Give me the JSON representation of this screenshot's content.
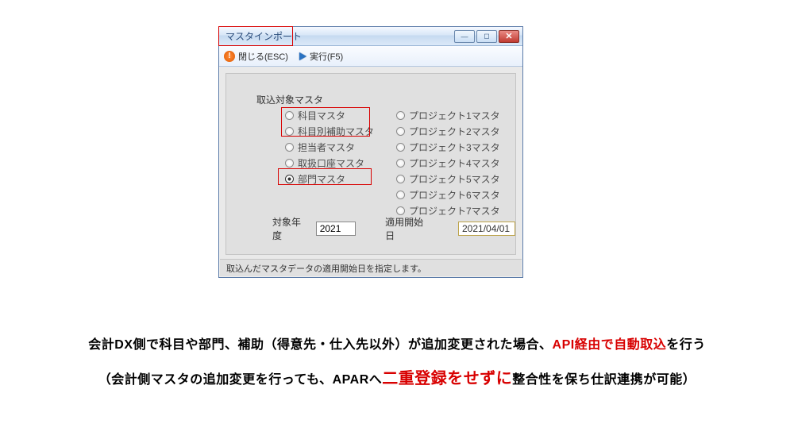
{
  "window": {
    "title": "マスタインポート"
  },
  "toolbar": {
    "close_label": "閉じる(ESC)",
    "run_label": "実行(F5)"
  },
  "group": {
    "label": "取込対象マスタ"
  },
  "radios_left": [
    {
      "label": "科目マスタ"
    },
    {
      "label": "科目別補助マスタ"
    },
    {
      "label": "担当者マスタ"
    },
    {
      "label": "取扱口座マスタ"
    },
    {
      "label": "部門マスタ"
    }
  ],
  "radios_right": [
    {
      "label": "プロジェクト1マスタ"
    },
    {
      "label": "プロジェクト2マスタ"
    },
    {
      "label": "プロジェクト3マスタ"
    },
    {
      "label": "プロジェクト4マスタ"
    },
    {
      "label": "プロジェクト5マスタ"
    },
    {
      "label": "プロジェクト6マスタ"
    },
    {
      "label": "プロジェクト7マスタ"
    }
  ],
  "fields": {
    "year_label": "対象年度",
    "year_value": "2021",
    "date_label": "適用開始日",
    "date_value": "2021/04/01"
  },
  "status": {
    "text": "取込んだマスタデータの適用開始日を指定します。"
  },
  "caption": {
    "l1_a": "会計DX側で科目や部門、補助（得意先・仕入先以外）が追加変更された場合、",
    "l1_b": "API経由で自動取込",
    "l1_c": "を行う",
    "l2_a": "（会計側マスタの追加変更を行っても、APARへ",
    "l2_b": "二重登録をせずに",
    "l2_c": "整合性を保ち仕訳連携が可能）"
  }
}
